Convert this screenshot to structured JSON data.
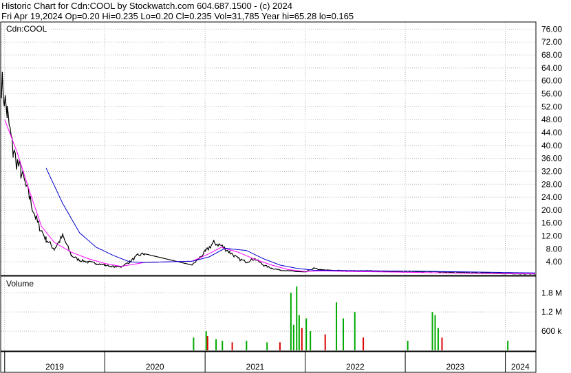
{
  "header": {
    "line1": "Historic Chart for Cdn:COOL by Stockwatch.com 604.687.1500 - (c) 2024",
    "line2": "Fri Apr 19,2024   Op=0.20   Hi=0.235   Lo=0.20   Cl=0.235   Vol=31,785   Year hi=65.28   lo=0.165"
  },
  "colors": {
    "price_bars": "#000000",
    "ma_short": "#ff00ff",
    "ma_long": "#0000cc",
    "vol_up": "#00aa00",
    "vol_down": "#dd0000",
    "grid": "#b8b8b8"
  },
  "chart_data": [
    {
      "type": "line",
      "panel": "price",
      "label": "Cdn:COOL",
      "y_ticks": [
        "76.00",
        "72.00",
        "68.00",
        "64.00",
        "60.00",
        "56.00",
        "52.00",
        "48.00",
        "44.00",
        "40.00",
        "36.00",
        "32.00",
        "28.00",
        "24.00",
        "20.00",
        "16.00",
        "12.00",
        "8.00",
        "4.00"
      ],
      "ylim": [
        0,
        78
      ],
      "x_labels": [
        "2019",
        "2020",
        "2021",
        "2022",
        "2023",
        "2024"
      ],
      "xlim": [
        "2018-12-20",
        "2024-04-19"
      ],
      "series": [
        {
          "kind": "price",
          "x": [
            "2018-12-20",
            "2019-01-10",
            "2019-02-01",
            "2019-03-01",
            "2019-04-01",
            "2019-05-01",
            "2019-06-01",
            "2019-07-01",
            "2019-08-01",
            "2019-09-01",
            "2019-10-01",
            "2019-11-01",
            "2019-12-01",
            "2020-01-01",
            "2020-02-01",
            "2020-03-01",
            "2020-04-01",
            "2020-05-01",
            "2020-05-25",
            "2020-11-15",
            "2021-01-01",
            "2021-02-01",
            "2021-03-01",
            "2021-04-01",
            "2021-05-01",
            "2021-06-01",
            "2021-07-01",
            "2021-08-01",
            "2021-09-01",
            "2021-10-01",
            "2021-11-01",
            "2021-12-01",
            "2022-01-01",
            "2022-02-01",
            "2022-03-01",
            "2022-06-01",
            "2022-09-01",
            "2022-12-01",
            "2023-03-01",
            "2023-06-01",
            "2023-09-01",
            "2023-12-01",
            "2024-02-01",
            "2024-04-19"
          ],
          "y": [
            60,
            50,
            38,
            32,
            24,
            16,
            11,
            8,
            12,
            6,
            4.5,
            4,
            3.5,
            3,
            2.5,
            2.5,
            4,
            6,
            6.5,
            3,
            7,
            10,
            9,
            7,
            5,
            4,
            5,
            3,
            2,
            1.5,
            1.2,
            1,
            0.8,
            2,
            1.5,
            1.2,
            1.2,
            0.9,
            1,
            0.8,
            0.6,
            0.5,
            0.3,
            0.235
          ]
        },
        {
          "kind": "ma_short",
          "x": [
            "2019-01-01",
            "2019-02-15",
            "2019-04-01",
            "2019-05-15",
            "2019-07-01",
            "2019-09-01",
            "2019-11-01",
            "2020-01-01",
            "2020-03-01",
            "2020-05-25",
            "2020-11-15",
            "2021-01-15",
            "2021-03-01",
            "2021-05-01",
            "2021-07-01",
            "2021-09-01",
            "2021-11-01",
            "2022-01-01",
            "2022-03-01",
            "2022-07-01",
            "2023-01-01",
            "2023-07-01",
            "2024-04-19"
          ],
          "y": [
            48,
            38,
            26,
            15,
            10,
            7,
            5,
            3.5,
            2.6,
            3.8,
            4.2,
            6.5,
            8.5,
            7,
            4.8,
            3,
            1.6,
            1,
            1.2,
            1,
            0.8,
            0.5,
            0.3
          ]
        },
        {
          "kind": "ma_long",
          "x": [
            "2019-06-01",
            "2019-08-01",
            "2019-10-01",
            "2019-12-01",
            "2020-02-01",
            "2020-04-01",
            "2020-05-25",
            "2020-11-15",
            "2021-01-15",
            "2021-03-15",
            "2021-06-01",
            "2021-08-01",
            "2021-10-01",
            "2021-12-01",
            "2022-02-01",
            "2022-06-01",
            "2022-10-01",
            "2023-02-01",
            "2023-08-01",
            "2024-04-19"
          ],
          "y": [
            33,
            22,
            13,
            8.5,
            6,
            4,
            3.8,
            4.2,
            5.5,
            8.2,
            7.5,
            5,
            3,
            2,
            1.4,
            1.3,
            1.2,
            1.1,
            0.9,
            0.6
          ]
        }
      ]
    },
    {
      "type": "bar",
      "panel": "volume",
      "label": "Volume",
      "y_ticks": [
        "1.8 M",
        "1.2 M",
        "600 k"
      ],
      "ylim": [
        0,
        2300000
      ],
      "x": [
        "2020-11-20",
        "2021-01-05",
        "2021-01-10",
        "2021-02-10",
        "2021-03-05",
        "2021-04-10",
        "2021-06-01",
        "2021-08-15",
        "2021-10-01",
        "2021-11-10",
        "2021-11-20",
        "2021-12-01",
        "2021-12-10",
        "2021-12-20",
        "2022-01-05",
        "2022-01-20",
        "2022-03-15",
        "2022-04-25",
        "2022-05-20",
        "2022-07-01",
        "2022-08-01",
        "2023-01-10",
        "2023-04-10",
        "2023-04-20",
        "2023-05-01",
        "2023-05-15",
        "2024-01-10"
      ],
      "values": [
        400000,
        600000,
        450000,
        350000,
        300000,
        250000,
        300000,
        250000,
        250000,
        1800000,
        800000,
        2000000,
        1100000,
        700000,
        1000000,
        600000,
        500000,
        1500000,
        1000000,
        1200000,
        400000,
        300000,
        1200000,
        1100000,
        700000,
        400000,
        300000
      ],
      "direction": [
        "up",
        "up",
        "down",
        "up",
        "up",
        "down",
        "up",
        "up",
        "down",
        "up",
        "up",
        "up",
        "up",
        "down",
        "up",
        "up",
        "down",
        "up",
        "up",
        "up",
        "down",
        "up",
        "up",
        "up",
        "up",
        "down",
        "up"
      ]
    }
  ]
}
